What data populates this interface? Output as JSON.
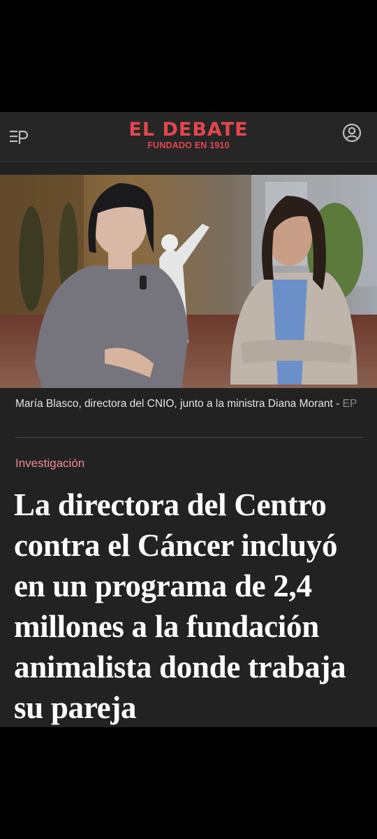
{
  "header": {
    "logo_name": "EL DEBATE",
    "logo_tagline": "FUNDADO EN 1910",
    "menu_icon": "menu-ep-icon",
    "account_icon": "user-circle-icon",
    "brand_color": "#e2474f"
  },
  "article": {
    "caption": "María Blasco, directora del CNIO, junto a la ministra Diana Morant",
    "caption_credit": "EP",
    "section": "Investigación",
    "headline": "La directora del Centro contra el Cáncer incluyó en un programa de 2,4 millones a la fundación animalista donde trabaja su pareja"
  }
}
